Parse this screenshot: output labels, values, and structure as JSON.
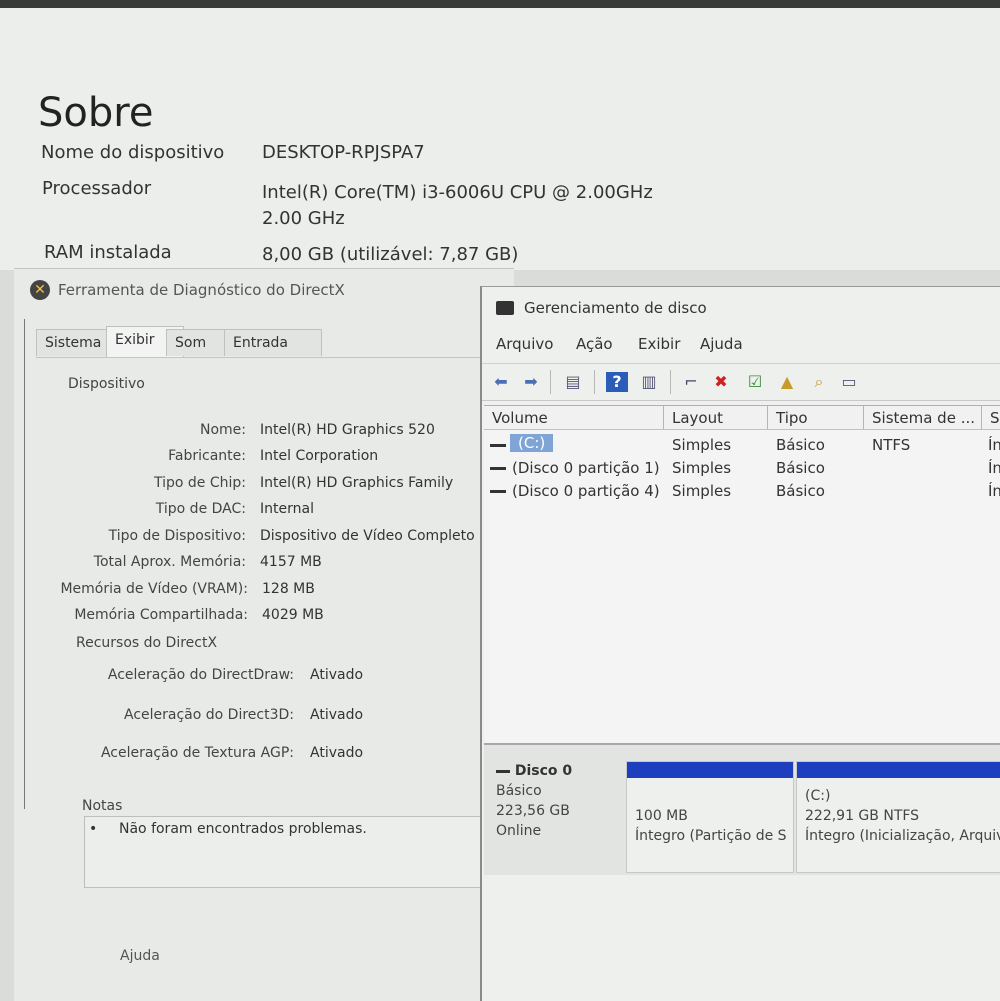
{
  "about": {
    "title": "Sobre",
    "device_name_label": "Nome do dispositivo",
    "device_name_value": "DESKTOP-RPJSPA7",
    "processor_label": "Processador",
    "processor_value_line1": "Intel(R) Core(TM) i3-6006U CPU @ 2.00GHz",
    "processor_value_line2": "2.00 GHz",
    "ram_label": "RAM instalada",
    "ram_value": "8,00 GB (utilizável: 7,87 GB)"
  },
  "directx": {
    "window_title": "Ferramenta de Diagnóstico do DirectX",
    "tabs": [
      "Sistema",
      "Exibir",
      "Som",
      "Entrada"
    ],
    "section_device": "Dispositivo",
    "fields": [
      {
        "label": "Nome:",
        "value": "Intel(R) HD Graphics 520"
      },
      {
        "label": "Fabricante:",
        "value": "Intel Corporation"
      },
      {
        "label": "Tipo de Chip:",
        "value": "Intel(R) HD Graphics Family"
      },
      {
        "label": "Tipo de DAC:",
        "value": "Internal"
      },
      {
        "label": "Tipo de Dispositivo:",
        "value": "Dispositivo de Vídeo Completo"
      },
      {
        "label": "Total Aprox. Memória:",
        "value": "4157 MB"
      },
      {
        "label": "Memória de Vídeo (VRAM):",
        "value": "128 MB"
      },
      {
        "label": "Memória Compartilhada:",
        "value": "4029 MB"
      }
    ],
    "section_resources": "Recursos do DirectX",
    "features": [
      {
        "label": "Aceleração do DirectDraw:",
        "value": "Ativado"
      },
      {
        "label": "Aceleração do Direct3D:",
        "value": "Ativado"
      },
      {
        "label": "Aceleração de Textura AGP:",
        "value": "Ativado"
      }
    ],
    "notes_label": "Notas",
    "notes_bullet": "•",
    "notes_text": "Não foram encontrados problemas.",
    "help_button": "Ajuda"
  },
  "disk_mgmt": {
    "window_title": "Gerenciamento de disco",
    "menu": [
      "Arquivo",
      "Ação",
      "Exibir",
      "Ajuda"
    ],
    "columns": [
      "Volume",
      "Layout",
      "Tipo",
      "Sistema de ...",
      "S"
    ],
    "rows": [
      {
        "volume": "(C:)",
        "layout": "Simples",
        "tipo": "Básico",
        "fs": "NTFS",
        "status": "Ín"
      },
      {
        "volume": "(Disco 0 partição 1)",
        "layout": "Simples",
        "tipo": "Básico",
        "fs": "",
        "status": "Ín"
      },
      {
        "volume": "(Disco 0 partição 4)",
        "layout": "Simples",
        "tipo": "Básico",
        "fs": "",
        "status": "Ín"
      }
    ],
    "disk": {
      "name": "Disco 0",
      "type": "Básico",
      "size": "223,56 GB",
      "status": "Online"
    },
    "partitions": [
      {
        "title": "",
        "size": "100 MB",
        "status": "Íntegro (Partição de S"
      },
      {
        "title": "(C:)",
        "size": "222,91 GB NTFS",
        "status": "Íntegro (Inicialização, Arquiv"
      }
    ],
    "partition_bar_color": "#1d3fbf",
    "selection_color": "#7fa4d6"
  }
}
